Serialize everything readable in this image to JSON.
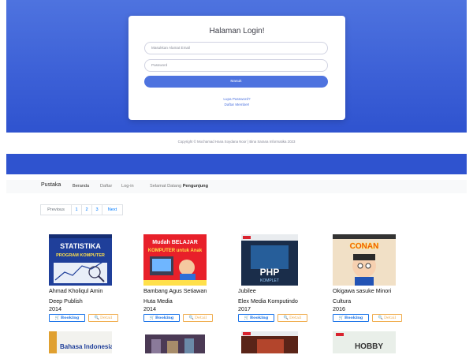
{
  "login": {
    "title": "Halaman Login!",
    "email_placeholder": "Masukkan Alamat Email",
    "password_placeholder": "Password",
    "submit_label": "Masuk",
    "forgot_label": "Lupa Password?",
    "register_label": "Daftar Member!"
  },
  "footer": {
    "copyright": "Copyright © Mochamad Hana Soydana Noor | Bina Sarana Informatika 2023"
  },
  "navbar": {
    "brand": "Pustaka",
    "items": [
      "Beranda",
      "Daftar",
      "Log-in"
    ],
    "welcome_prefix": "Selamat Datang",
    "welcome_user": "Pengunjung"
  },
  "pagination": {
    "prev": "Previous",
    "pages": [
      "1",
      "2",
      "3"
    ],
    "next": "Next"
  },
  "books": [
    {
      "author": "Ahmad Kholiqul Amin",
      "publisher": "Deep Publish",
      "year": "2014",
      "cover_title": "STATISTIKA",
      "cover_sub": "PROGRAM KOMPUTER",
      "cover_color": "#1f3f9a"
    },
    {
      "author": "Bambang Agus Setiawan",
      "publisher": "Huta Media",
      "year": "2014",
      "cover_title": "Mudah BELAJAR",
      "cover_sub": "KOMPUTER untuk Anak",
      "cover_color": "#e8202a"
    },
    {
      "author": "Jubilee",
      "publisher": "Elex Media Komputindo",
      "year": "2017",
      "cover_title": "PHP",
      "cover_sub": "KOMPLET",
      "cover_color": "#1a2d4a"
    },
    {
      "author": "Okigawa sasuke Minori",
      "publisher": "Cultura",
      "year": "2016",
      "cover_title": "CONAN",
      "cover_sub": "",
      "cover_color": "#f1e0c6"
    }
  ],
  "book_buttons": {
    "booking": "Booking",
    "detail": "Detail"
  },
  "second_row": [
    {
      "cover_title": "Bahasa Indonesia",
      "cover_color": "#f2f2ee"
    },
    {
      "cover_title": "",
      "cover_color": "#4b3a55"
    },
    {
      "cover_title": "",
      "cover_color": "#5a2418"
    },
    {
      "cover_title": "HOBBY",
      "cover_color": "#e9efe9"
    }
  ]
}
